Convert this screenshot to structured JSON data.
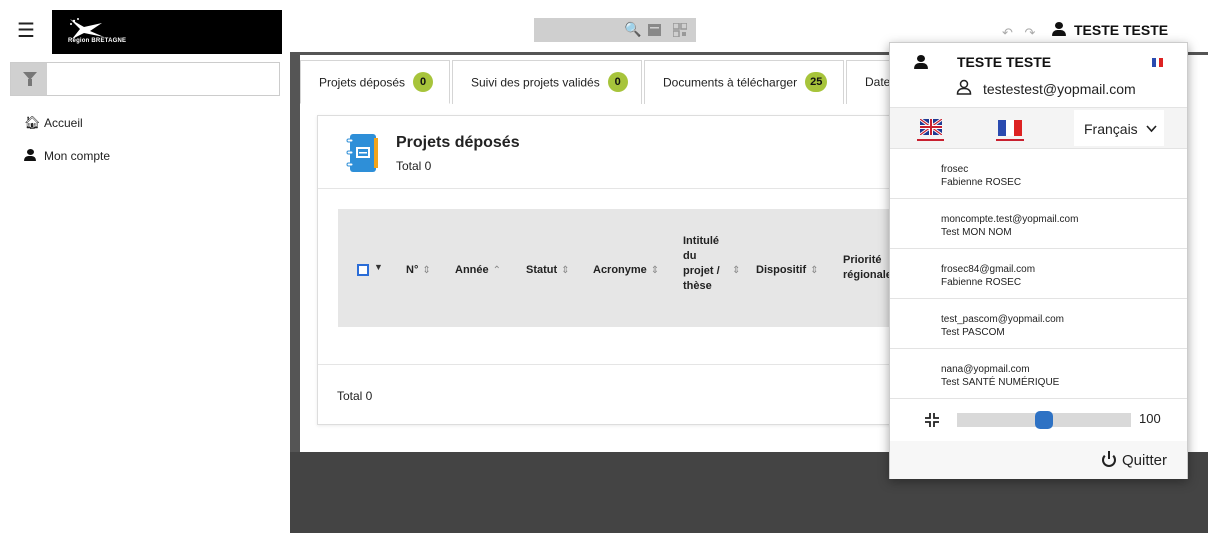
{
  "header": {
    "logo_text": "Région BRETAGNE",
    "user_name": "TESTE TESTE"
  },
  "sidebar": {
    "items": [
      {
        "label": "Accueil",
        "icon": "home-icon"
      },
      {
        "label": "Mon compte",
        "icon": "user-icon"
      }
    ]
  },
  "tabs": [
    {
      "label": "Projets déposés",
      "count": "0"
    },
    {
      "label": "Suivi des projets validés",
      "count": "0"
    },
    {
      "label": "Documents à télécharger",
      "count": "25"
    },
    {
      "label": "Date"
    }
  ],
  "card": {
    "title": "Projets déposés",
    "subtitle": "Total 0",
    "footer": "Total 0",
    "columns": {
      "num": "N°",
      "annee": "Année",
      "statut": "Statut",
      "acronyme": "Acronyme",
      "intitule_l1": "Intitulé",
      "intitule_l2": "du",
      "intitule_l3": "projet /",
      "intitule_l4": "thèse",
      "dispositif": "Dispositif",
      "priorite_l1": "Priorité",
      "priorite_l2": "régionale"
    }
  },
  "dropdown": {
    "name": "TESTE TESTE",
    "email": "testestest@yopmail.com",
    "language": "Français",
    "accounts": [
      {
        "login": "frosec",
        "name": "Fabienne ROSEC"
      },
      {
        "login": "moncompte.test@yopmail.com",
        "name": "Test MON NOM"
      },
      {
        "login": "frosec84@gmail.com",
        "name": "Fabienne ROSEC"
      },
      {
        "login": "test_pascom@yopmail.com",
        "name": "Test PASCOM"
      },
      {
        "login": "nana@yopmail.com",
        "name": "Test SANTÉ NUMÉRIQUE"
      }
    ],
    "zoom_value": "100",
    "quit_label": "Quitter"
  },
  "colors": {
    "badge": "#a7c43b",
    "accent_blue": "#2e72c4",
    "dark_bg": "#444444"
  }
}
